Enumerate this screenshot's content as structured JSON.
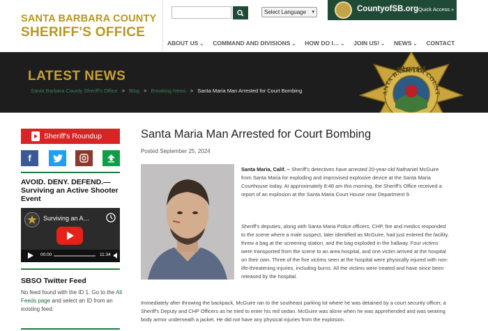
{
  "header": {
    "logo_line1": "SANTA BARBARA COUNTY",
    "logo_line2": "SHERIFF'S OFFICE",
    "search": {
      "placeholder": ""
    },
    "language_select": "Select Language",
    "county_site": "CountyofSB.org",
    "quick_access": "Quick Access »",
    "nav": [
      {
        "label": "ABOUT US",
        "has_dropdown": true
      },
      {
        "label": "COMMAND AND DIVISIONS",
        "has_dropdown": true
      },
      {
        "label": "HOW DO I…",
        "has_dropdown": true
      },
      {
        "label": "JOIN US!",
        "has_dropdown": true
      },
      {
        "label": "NEWS",
        "has_dropdown": true
      },
      {
        "label": "CONTACT",
        "has_dropdown": false
      }
    ]
  },
  "banner": {
    "title": "LATEST NEWS",
    "breadcrumbs": [
      "Santa Barbara County Sheriff's Office",
      "Blog",
      "Breaking News"
    ],
    "current": "Santa Maria Man Arrested for Court Bombing",
    "badge_top": "Sheriff",
    "badge_ring": "SANTA BARBARA COUNTY"
  },
  "sidebar": {
    "roundup_label": "Sheriff's Roundup",
    "social": {
      "facebook": "f",
      "twitter": "t",
      "instagram": "ig",
      "share": "↑"
    },
    "avoid_heading": "AVOID. DENY. DEFEND.— Surviving an Active Shooter Event",
    "video": {
      "title": "Surviving an A…",
      "time_current": "00:00",
      "time_total": "11:34"
    },
    "twitter_heading": "SBSO Twitter Feed",
    "twitter_text_1": "No feed found with the ID 1. Go to the ",
    "twitter_link": "All Feeds page",
    "twitter_text_2": " and select an ID from an existing feed."
  },
  "article": {
    "title": "Santa Maria Man Arrested for Court Bombing",
    "posted": "Posted September 25, 2024",
    "dateline": "Santa Maria, Calif. –",
    "p1": " Sheriff's detectives have arrested 20-year-old Nathaniel McGuire from Santa Maria for exploding and improvised explosive device at the Santa Maria Courthouse today. At approximately 8:48 am this morning, the Sheriff's Office received a report of an explosion at the Santa Maria Court House near Department 9.",
    "p2": "Sheriff's deputies, along with Santa Maria Police officers, CHP, fire and medics responded to the scene where a male suspect, later identified as McGuire, had just entered the facility, threw a bag at the screening station, and the bag exploded in the hallway. Four victims were transported from the scene to an area hospital, and one victim arrived at the hospital on their own. Three of the five victims seen at the hospital were physically injured with non-life-threatening injuries, including burns. All the victims were treated and have since been released by the hospital.",
    "p3": "Immediately after throwing the backpack, McGuire ran to the southeast parking lot where he was detained by a court security officer, a Sheriff's Deputy and CHP Officers as he tried to enter his red sedan. McGuire was alone when he was apprehended and was wearing body armor underneath a jacket. He did not have any physical injuries from the explosion."
  },
  "colors": {
    "gold": "#b8961c",
    "green": "#1f4a36",
    "banner": "#1d1d1d",
    "red": "#d72424"
  }
}
